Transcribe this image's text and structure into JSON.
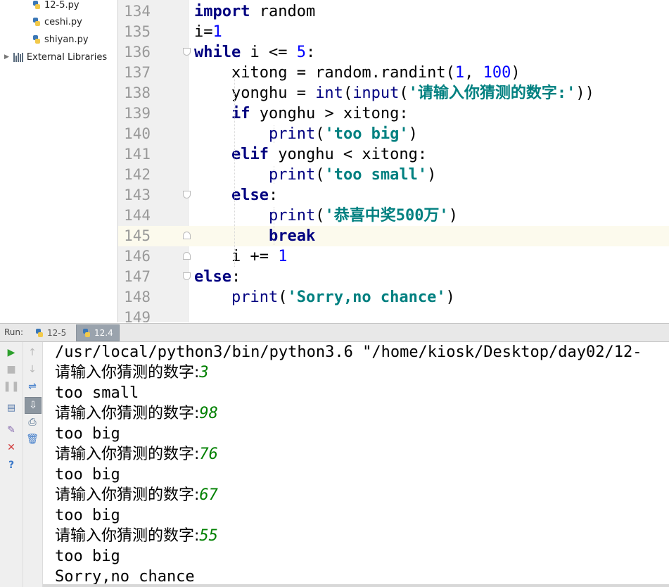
{
  "project_tree": {
    "items": [
      {
        "label": "12-5.py",
        "icon": "python-file-icon"
      },
      {
        "label": "ceshi.py",
        "icon": "python-file-icon"
      },
      {
        "label": "shiyan.py",
        "icon": "python-file-icon"
      }
    ],
    "external_libraries": {
      "label": "External Libraries",
      "icon": "library-icon"
    }
  },
  "editor": {
    "lines": [
      {
        "num": "134",
        "tokens": [
          [
            "kw",
            "import"
          ],
          [
            "id",
            " random"
          ]
        ]
      },
      {
        "num": "135",
        "tokens": [
          [
            "id",
            "i="
          ],
          [
            "num",
            "1"
          ]
        ]
      },
      {
        "num": "136",
        "tokens": [
          [
            "kw",
            "while"
          ],
          [
            "id",
            " i <= "
          ],
          [
            "num",
            "5"
          ],
          [
            "id",
            ":"
          ]
        ]
      },
      {
        "num": "137",
        "tokens": [
          [
            "id",
            "    xitong = random.randint("
          ],
          [
            "num",
            "1"
          ],
          [
            "id",
            ", "
          ],
          [
            "num",
            "100"
          ],
          [
            "id",
            ")"
          ]
        ]
      },
      {
        "num": "138",
        "tokens": [
          [
            "id",
            "    yonghu = "
          ],
          [
            "fn",
            "int"
          ],
          [
            "id",
            "("
          ],
          [
            "fn",
            "input"
          ],
          [
            "id",
            "("
          ],
          [
            "str",
            "'请输入你猜测的数字:'"
          ],
          [
            "id",
            "))"
          ]
        ]
      },
      {
        "num": "139",
        "tokens": [
          [
            "id",
            "    "
          ],
          [
            "kw",
            "if"
          ],
          [
            "id",
            " yonghu > xitong:"
          ]
        ]
      },
      {
        "num": "140",
        "tokens": [
          [
            "id",
            "        "
          ],
          [
            "fn",
            "print"
          ],
          [
            "id",
            "("
          ],
          [
            "str",
            "'too big'"
          ],
          [
            "id",
            ")"
          ]
        ]
      },
      {
        "num": "141",
        "tokens": [
          [
            "id",
            "    "
          ],
          [
            "kw",
            "elif"
          ],
          [
            "id",
            " yonghu < xitong:"
          ]
        ]
      },
      {
        "num": "142",
        "tokens": [
          [
            "id",
            "        "
          ],
          [
            "fn",
            "print"
          ],
          [
            "id",
            "("
          ],
          [
            "str",
            "'too small'"
          ],
          [
            "id",
            ")"
          ]
        ]
      },
      {
        "num": "143",
        "tokens": [
          [
            "id",
            "    "
          ],
          [
            "kw",
            "else"
          ],
          [
            "id",
            ":"
          ]
        ]
      },
      {
        "num": "144",
        "tokens": [
          [
            "id",
            "        "
          ],
          [
            "fn",
            "print"
          ],
          [
            "id",
            "("
          ],
          [
            "str",
            "'恭喜中奖500万'"
          ],
          [
            "id",
            ")"
          ]
        ]
      },
      {
        "num": "145",
        "tokens": [
          [
            "id",
            "        "
          ],
          [
            "kw",
            "break"
          ]
        ]
      },
      {
        "num": "146",
        "tokens": [
          [
            "id",
            "    i += "
          ],
          [
            "num",
            "1"
          ]
        ]
      },
      {
        "num": "147",
        "tokens": [
          [
            "kw",
            "else"
          ],
          [
            "id",
            ":"
          ]
        ]
      },
      {
        "num": "148",
        "tokens": [
          [
            "id",
            "    "
          ],
          [
            "fn",
            "print"
          ],
          [
            "id",
            "("
          ],
          [
            "str",
            "'Sorry,no chance'"
          ],
          [
            "id",
            ")"
          ]
        ]
      },
      {
        "num": "149",
        "tokens": []
      }
    ],
    "current_line": "145"
  },
  "run_panel": {
    "label": "Run:",
    "tabs": [
      {
        "label": "12-5",
        "active": false
      },
      {
        "label": "12.4",
        "active": true
      }
    ]
  },
  "console": {
    "lines": [
      {
        "text": "/usr/local/python3/bin/python3.6 \"/home/kiosk/Desktop/day02/12-",
        "input": ""
      },
      {
        "text": "请输入你猜测的数字:",
        "input": "3"
      },
      {
        "text": "too small",
        "input": ""
      },
      {
        "text": "请输入你猜测的数字:",
        "input": "98"
      },
      {
        "text": "too big",
        "input": ""
      },
      {
        "text": "请输入你猜测的数字:",
        "input": "76"
      },
      {
        "text": "too big",
        "input": ""
      },
      {
        "text": "请输入你猜测的数字:",
        "input": "67"
      },
      {
        "text": "too big",
        "input": ""
      },
      {
        "text": "请输入你猜测的数字:",
        "input": "55"
      },
      {
        "text": "too big",
        "input": ""
      },
      {
        "text": "Sorry,no chance",
        "input": ""
      }
    ]
  },
  "colors": {
    "keyword": "#000080",
    "number": "#0000ff",
    "string": "#008080",
    "console_input": "#008000",
    "current_line": "#fcfaed"
  }
}
